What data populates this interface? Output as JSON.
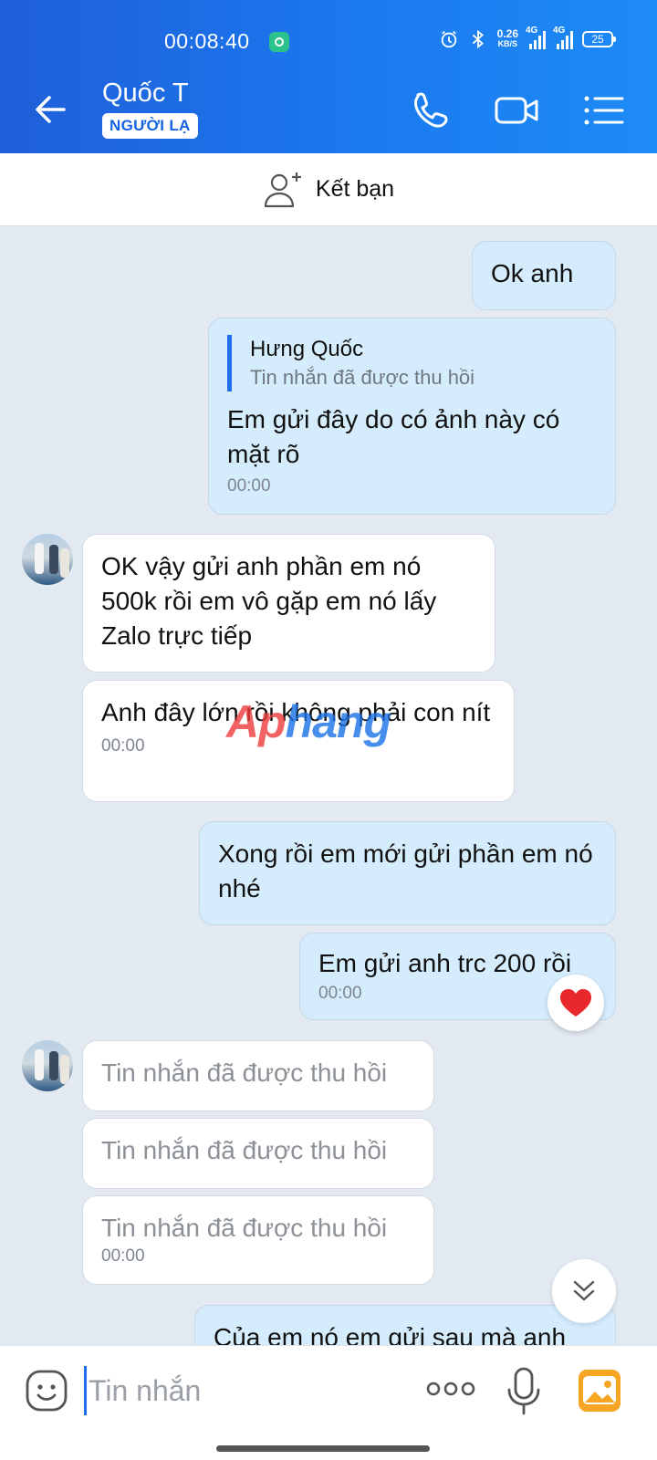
{
  "status_bar": {
    "time": "00:08:40",
    "net_speed": "0.26",
    "net_unit": "KB/S",
    "signal1": "4G",
    "signal2": "4G",
    "battery": "25"
  },
  "header": {
    "name": "Quốc T",
    "badge": "NGƯỜI LẠ"
  },
  "add_friend": {
    "label": "Kết bạn"
  },
  "messages": {
    "m1": {
      "text": "Ok anh"
    },
    "m2": {
      "quote_name": "Hưng Quốc",
      "quote_text": "Tin nhắn đã được thu hồi",
      "text": "Em gửi đây do có ảnh này có mặt rõ",
      "time": "00:00"
    },
    "m3": {
      "text": "OK vậy gửi anh phần em nó 500k rồi em vô gặp em nó lấy Zalo trực tiếp"
    },
    "m4": {
      "text": "Anh đây lớn rồi không phải con nít",
      "time": "00:00"
    },
    "m5": {
      "text": "Xong rồi em mới gửi phần em nó nhé"
    },
    "m6": {
      "text": "Em gửi anh trc 200 rồi",
      "time": "00:00"
    },
    "m7": {
      "text": "Tin nhắn đã được thu hồi"
    },
    "m8": {
      "text": "Tin nhắn đã được thu hồi"
    },
    "m9": {
      "text": "Tin nhắn đã được thu hồi",
      "time": "00:00"
    },
    "m10": {
      "text": "Của em nó em gửi sau mà anh"
    }
  },
  "watermark": {
    "part1": "Ap",
    "part2": "hang"
  },
  "input": {
    "placeholder": "Tin nhắn"
  },
  "colors": {
    "brand_blue": "#1b79ef",
    "outgoing_bubble": "#d5ecfd",
    "incoming_bubble": "#ffffff",
    "reaction_heart": "#e8282d"
  }
}
